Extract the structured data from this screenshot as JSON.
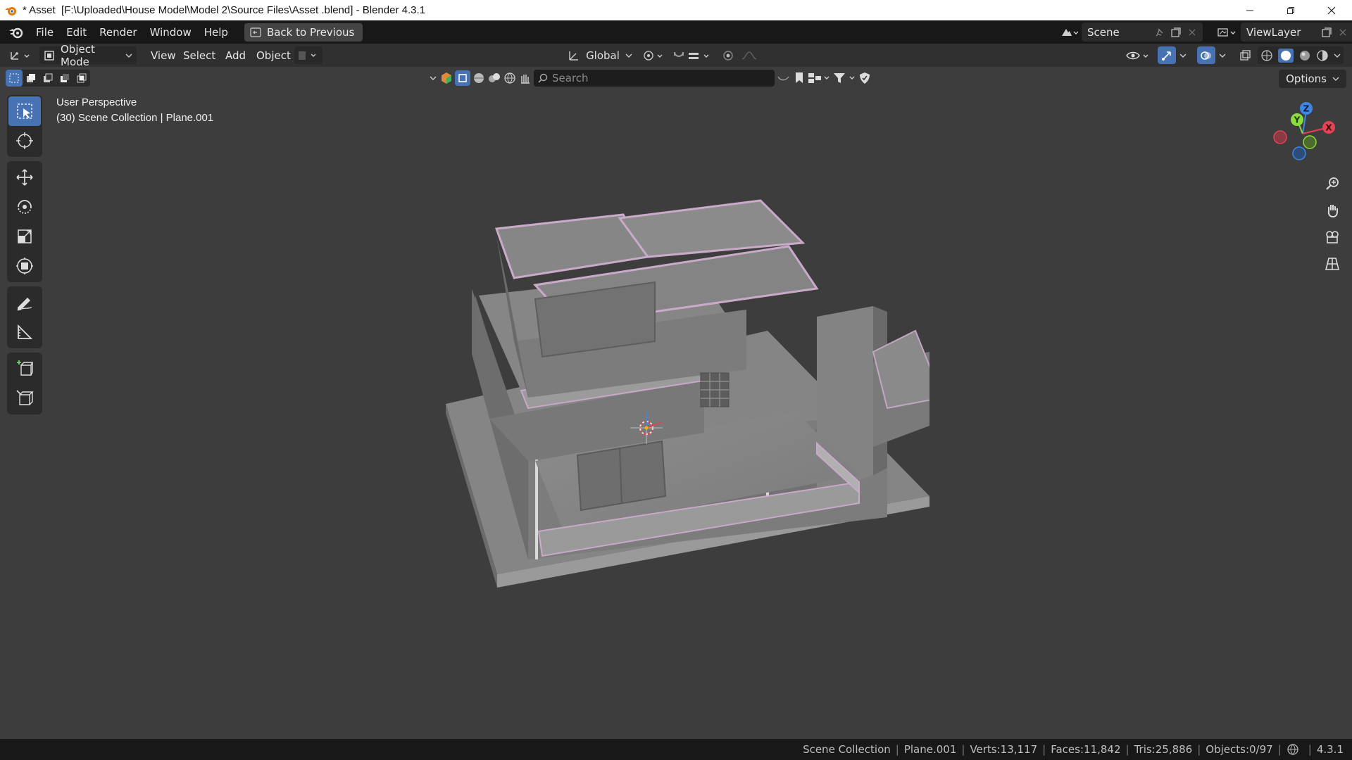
{
  "window": {
    "title": "* Asset  [F:\\Uploaded\\House Model\\Model 2\\Source Files\\Asset .blend] - Blender 4.3.1"
  },
  "menubar": {
    "items": [
      "File",
      "Edit",
      "Render",
      "Window",
      "Help"
    ],
    "back_button": "Back to Previous",
    "scene": "Scene",
    "view_layer": "ViewLayer"
  },
  "viewport_header": {
    "mode": "Object Mode",
    "menus": [
      "View",
      "Select",
      "Add",
      "Object"
    ],
    "transform_orientation": "Global",
    "search_placeholder": "Search",
    "options": "Options"
  },
  "viewport": {
    "perspective": "User Perspective",
    "collection_info": "(30) Scene Collection | Plane.001",
    "gizmo_axes": [
      "Z",
      "Y",
      "X"
    ],
    "colors": {
      "x_axis": "#e44356",
      "y_axis": "#8bdc3c",
      "z_axis": "#3d87e6",
      "accent": "#4772b3"
    }
  },
  "statusbar": {
    "collection": "Scene Collection",
    "object": "Plane.001",
    "verts": "Verts:13,117",
    "faces": "Faces:11,842",
    "tris": "Tris:25,886",
    "objects": "Objects:0/97",
    "version": "4.3.1"
  }
}
